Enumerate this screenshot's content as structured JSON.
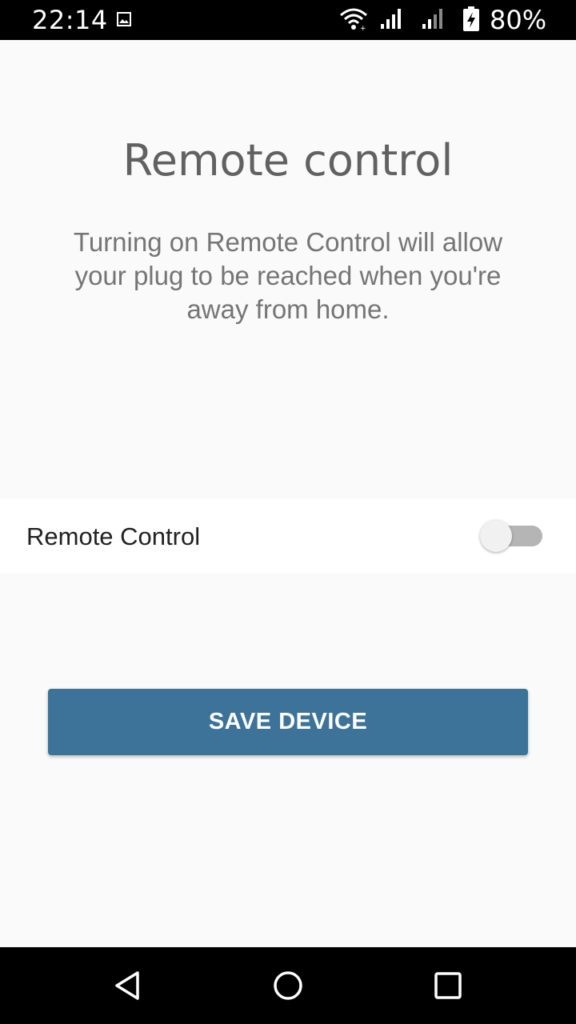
{
  "status_bar": {
    "time": "22:14",
    "battery_percent": "80%",
    "icons": [
      "image-notification-icon",
      "wifi-icon",
      "cell-signal-icon",
      "cell-signal-icon",
      "battery-charging-icon"
    ]
  },
  "main": {
    "title": "Remote control",
    "description": "Turning on Remote Control will allow your plug to be reached when you're away from home."
  },
  "setting": {
    "label": "Remote Control",
    "enabled": false
  },
  "actions": {
    "save_label": "SAVE DEVICE"
  },
  "nav_bar": {
    "icons": [
      "back-icon",
      "home-icon",
      "recents-icon"
    ]
  },
  "colors": {
    "primary": "#3d7399",
    "status_bar": "#000000",
    "background": "#fafafa",
    "title_text": "#616161",
    "toggle_track_off": "#b5b5b5"
  }
}
